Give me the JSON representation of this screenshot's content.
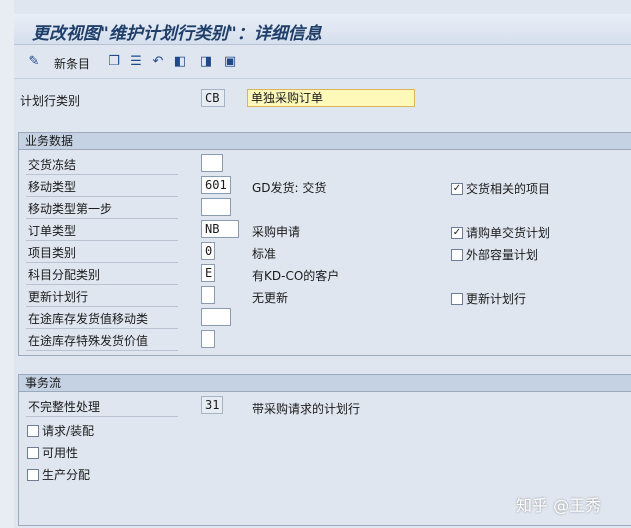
{
  "title": "更改视图\"维护计划行类别\"：详细信息",
  "toolbar": {
    "new_entry": "新条目"
  },
  "header_field": {
    "label": "计划行类别",
    "code": "CB",
    "description": "单独采购订单"
  },
  "business_data": {
    "title": "业务数据",
    "rows": [
      {
        "label": "交货冻结",
        "value": "",
        "desc": ""
      },
      {
        "label": "移动类型",
        "value": "601",
        "desc": "GD发货: 交货"
      },
      {
        "label": "移动类型第一步",
        "value": "",
        "desc": ""
      },
      {
        "label": "订单类型",
        "value": "NB",
        "desc": "采购申请"
      },
      {
        "label": "项目类别",
        "value": "0",
        "desc": "标准"
      },
      {
        "label": "科目分配类别",
        "value": "E",
        "desc": "有KD-CO的客户"
      },
      {
        "label": "更新计划行",
        "value": "",
        "desc": "无更新"
      },
      {
        "label": "在途库存发货值移动类",
        "value": "",
        "desc": ""
      },
      {
        "label": "在途库存特殊发货价值",
        "value": "",
        "desc": ""
      }
    ],
    "checkboxes": [
      {
        "label": "交货相关的项目",
        "checked": "✓"
      },
      {
        "label": "请购单交货计划",
        "checked": "✓"
      },
      {
        "label": "外部容量计划",
        "checked": ""
      },
      {
        "label": "更新计划行",
        "checked": ""
      }
    ]
  },
  "transaction_flow": {
    "title": "事务流",
    "incomplete_label": "不完整性处理",
    "incomplete_value": "31",
    "incomplete_desc": "带采购请求的计划行",
    "checkboxes": [
      {
        "label": "请求/装配",
        "checked": ""
      },
      {
        "label": "可用性",
        "checked": ""
      },
      {
        "label": "生产分配",
        "checked": ""
      }
    ]
  },
  "watermark": "知乎 @王秀"
}
